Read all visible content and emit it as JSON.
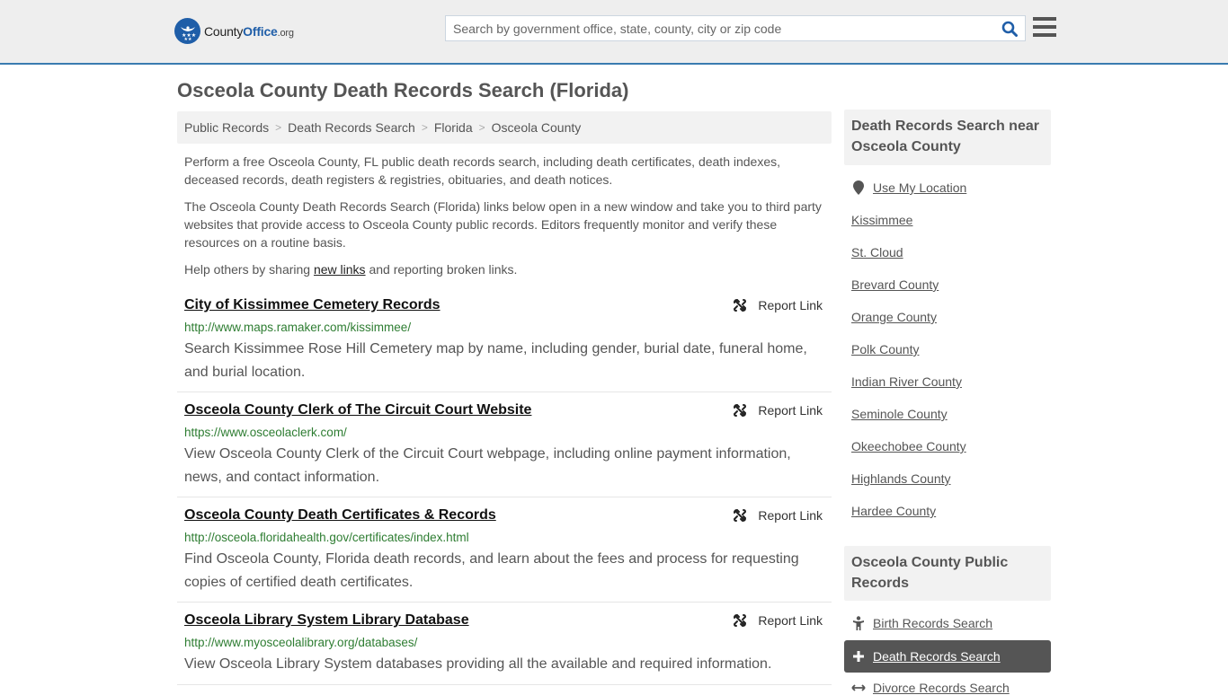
{
  "header": {
    "logo": {
      "name_part1": "County",
      "name_part2": "Office",
      "tld": ".org"
    },
    "search": {
      "placeholder": "Search by government office, state, county, city or zip code",
      "value": ""
    },
    "colors": {
      "brand": "#1f5ea8",
      "accent_border": "#3a7cb0",
      "url_green": "#2e7d32"
    }
  },
  "main": {
    "title": "Osceola County Death Records Search (Florida)",
    "breadcrumb": [
      "Public Records",
      "Death Records Search",
      "Florida",
      "Osceola County"
    ],
    "intro": {
      "p1": "Perform a free Osceola County, FL public death records search, including death certificates, death indexes, deceased records, death registers & registries, obituaries, and death notices.",
      "p2": "The Osceola County Death Records Search (Florida) links below open in a new window and take you to third party websites that provide access to Osceola County public records. Editors frequently monitor and verify these resources on a routine basis.",
      "p3_before": "Help others by sharing ",
      "p3_link": "new links",
      "p3_after": " and reporting broken links."
    },
    "report_label": "Report Link",
    "listings": [
      {
        "title": "City of Kissimmee Cemetery Records",
        "url": "http://www.maps.ramaker.com/kissimmee/",
        "description": "Search Kissimmee Rose Hill Cemetery map by name, including gender, burial date, funeral home, and burial location."
      },
      {
        "title": "Osceola County Clerk of The Circuit Court Website",
        "url": "https://www.osceolaclerk.com/",
        "description": "View Osceola County Clerk of the Circuit Court webpage, including online payment information, news, and contact information."
      },
      {
        "title": "Osceola County Death Certificates & Records",
        "url": "http://osceola.floridahealth.gov/certificates/index.html",
        "description": "Find Osceola County, Florida death records, and learn about the fees and process for requesting copies of certified death certificates."
      },
      {
        "title": "Osceola Library System Library Database",
        "url": "http://www.myosceolalibrary.org/databases/",
        "description": "View Osceola Library System databases providing all the available and required information."
      }
    ]
  },
  "sidebar": {
    "nearby": {
      "heading": "Death Records Search near Osceola County",
      "use_location": "Use My Location",
      "links": [
        "Kissimmee",
        "St. Cloud",
        "Brevard County",
        "Orange County",
        "Polk County",
        "Indian River County",
        "Seminole County",
        "Okeechobee County",
        "Highlands County",
        "Hardee County"
      ]
    },
    "public_records": {
      "heading": "Osceola County Public Records",
      "items": [
        {
          "label": "Birth Records Search",
          "icon": "child-icon",
          "active": false
        },
        {
          "label": "Death Records Search",
          "icon": "plus-icon",
          "active": true
        },
        {
          "label": "Divorce Records Search",
          "icon": "arrows-horizontal-icon",
          "active": false
        }
      ]
    }
  }
}
